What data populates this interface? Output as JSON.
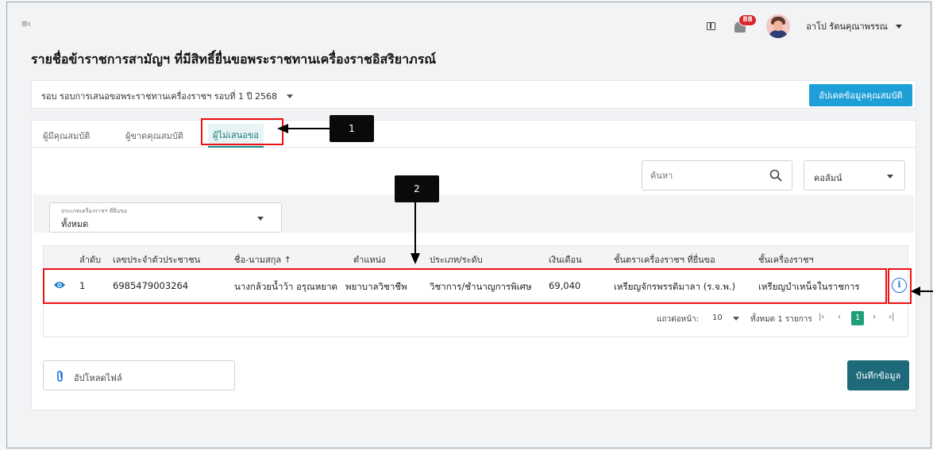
{
  "header": {
    "notification_count": "88",
    "user_name": "อาโป รัตนคุณาพรรณ"
  },
  "page_title": "รายชื่อข้าราชการสามัญฯ ที่มีสิทธิ์ยื่นขอพระราชทานเครื่องราชอิสริยาภรณ์",
  "round": {
    "label": "รอบ รอบการเสนอขอพระราชทานเครื่องราชฯ รอบที่ 1 ปี 2568"
  },
  "update_button": "อัปเดตข้อมูลคุณสมบัติ",
  "tabs": [
    {
      "label": "ผู้มีคุณสมบัติ"
    },
    {
      "label": "ผู้ขาดคุณสมบัติ"
    },
    {
      "label": "ผู้ไม่เสนอขอ"
    }
  ],
  "search": {
    "placeholder": "ค้นหา"
  },
  "column_select": "คอลัมน์",
  "filter": {
    "label": "ประเภทเครื่องราชฯ ที่ยื่นขอ",
    "value": "ทั้งหมด"
  },
  "table": {
    "headers": [
      "ลำดับ",
      "เลขประจำตัวประชาชน",
      "ชื่อ-นามสกุล ↑",
      "ตำแหน่ง",
      "ประเภท/ระดับ",
      "เงินเดือน",
      "ชั้นตราเครื่องราชฯ ที่ยื่นขอ",
      "ชั้นเครื่องราชฯ"
    ],
    "rows": [
      [
        "1",
        "6985479003264",
        "นางกล้วยน้ำว้า อรุณหยาด",
        "พยาบาลวิชาชีพ",
        "วิชาการ/ชำนาญการพิเศษ",
        "69,040",
        "เหรียญจักรพรรดิมาลา (ร.จ.พ.)",
        "เหรียญบำเหน็จในราชการ"
      ]
    ]
  },
  "pager": {
    "rows_per_page_label": "แถวต่อหน้า:",
    "rows_per_page": "10",
    "total": "ทั้งหมด 1 รายการ",
    "current_page": "1"
  },
  "upload_button": "อัปโหลดไฟล์",
  "save_button": "บันทึกข้อมูล",
  "callouts": [
    "1",
    "2"
  ],
  "colors": {
    "accent": "#1e9fd8",
    "save": "#1e6a7a",
    "highlight": "#e11111",
    "badge": "#d7282f"
  }
}
